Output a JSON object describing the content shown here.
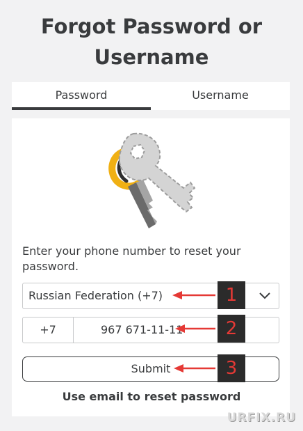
{
  "header": {
    "title_line1": "Forgot Password or",
    "title_line2": "Username"
  },
  "tabs": [
    {
      "label": "Password",
      "active": true
    },
    {
      "label": "Username",
      "active": false
    }
  ],
  "form": {
    "instructions": "Enter your phone number to reset your password.",
    "country_value": "Russian Federation (+7)",
    "phone_code": "+7",
    "phone_value": "967 671-11-11",
    "submit_label": "Submit",
    "email_link": "Use email to reset password"
  },
  "annotations": [
    {
      "number": "1"
    },
    {
      "number": "2"
    },
    {
      "number": "3"
    }
  ],
  "watermark": "URFIX.RU",
  "icons": {
    "illustration": "key-icon",
    "chevron": "chevron-down-icon",
    "arrow": "arrow-left-icon"
  },
  "colors": {
    "page_background": "#f2f2f3",
    "text": "#393b3d",
    "annotation_red": "#e53935",
    "key_gold": "#f0b014",
    "key_gray": "#d4d4d4"
  }
}
